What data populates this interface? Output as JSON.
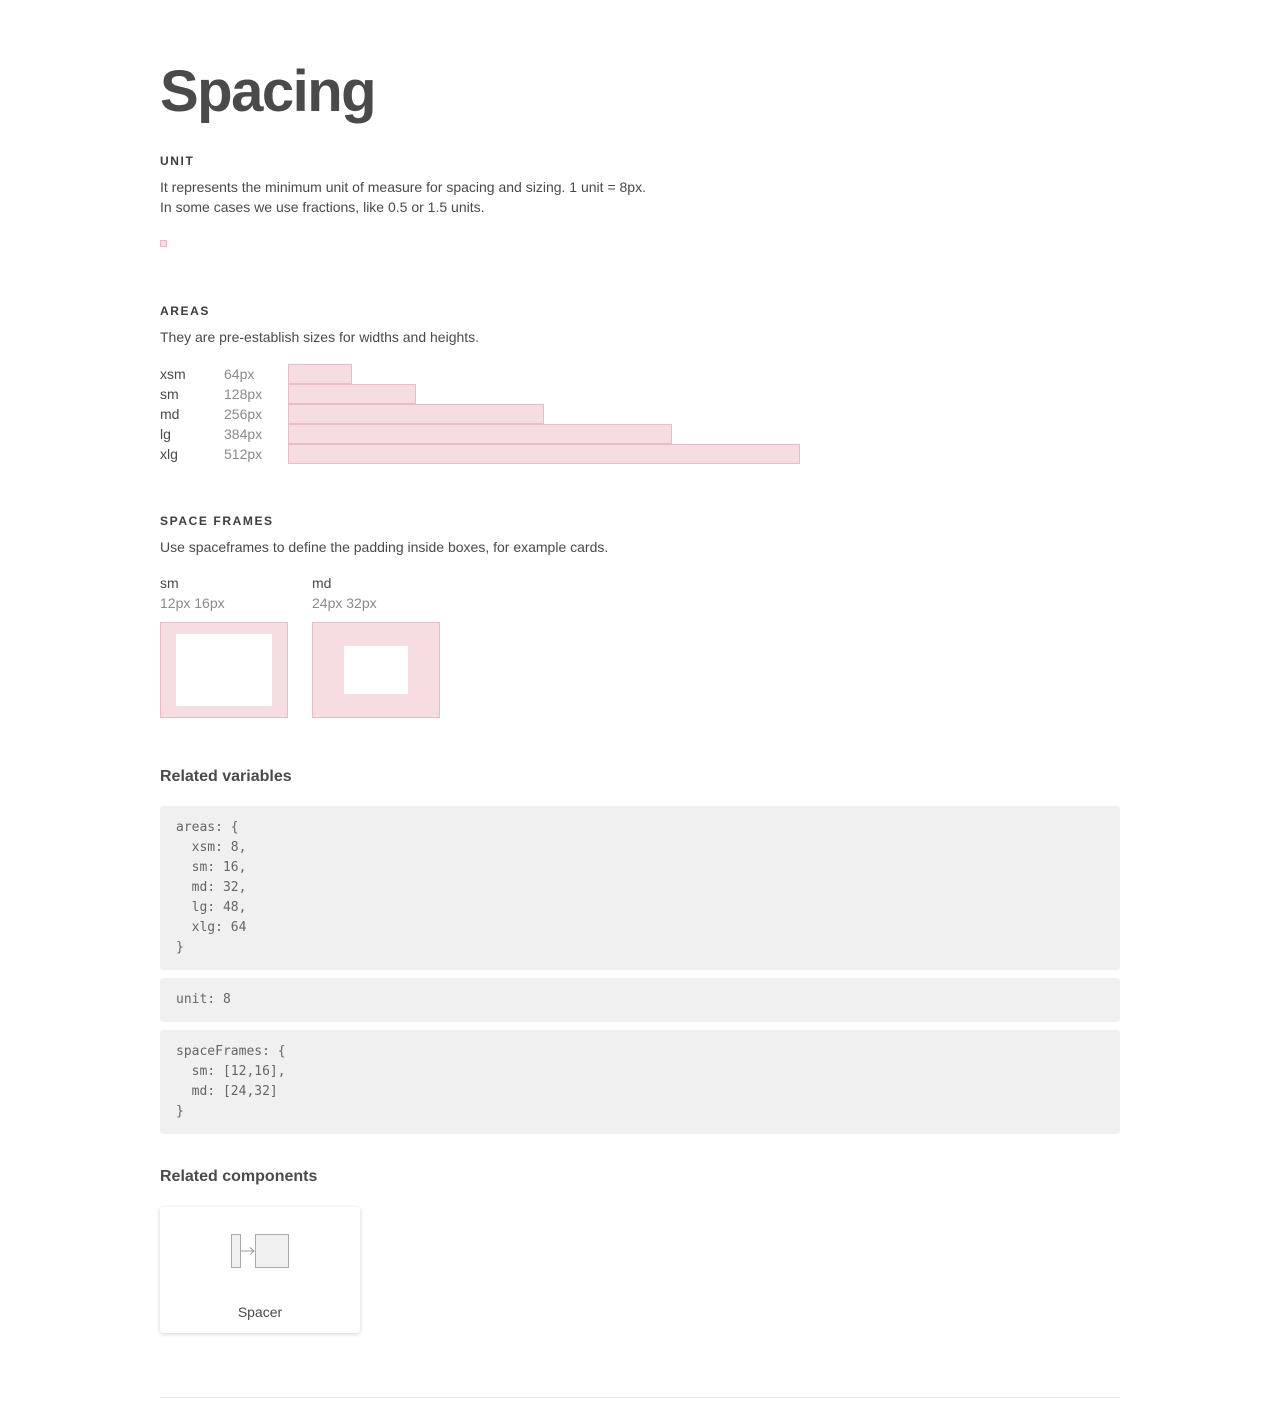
{
  "page": {
    "title": "Spacing"
  },
  "unit": {
    "label": "UNIT",
    "line1": "It represents the minimum unit of measure for spacing and sizing. 1 unit = 8px.",
    "line2": "In some cases we use fractions, like 0.5 or 1.5 units."
  },
  "areas": {
    "label": "AREAS",
    "description": "They are pre-establish sizes for widths and heights.",
    "rows": [
      {
        "name": "xsm",
        "size": "64px"
      },
      {
        "name": "sm",
        "size": "128px"
      },
      {
        "name": "md",
        "size": "256px"
      },
      {
        "name": "lg",
        "size": "384px"
      },
      {
        "name": "xlg",
        "size": "512px"
      }
    ]
  },
  "space_frames": {
    "label": "SPACE FRAMES",
    "description": "Use spaceframes to define the padding inside boxes, for example cards.",
    "frames": [
      {
        "name": "sm",
        "value": "12px 16px"
      },
      {
        "name": "md",
        "value": "24px 32px"
      }
    ]
  },
  "related_variables": {
    "heading": "Related variables",
    "blocks": [
      "areas: {\n  xsm: 8,\n  sm: 16,\n  md: 32,\n  lg: 48,\n  xlg: 64\n}",
      "unit: 8",
      "spaceFrames: {\n  sm: [12,16],\n  md: [24,32]\n}"
    ]
  },
  "related_components": {
    "heading": "Related components",
    "items": [
      {
        "label": "Spacer",
        "icon": "spacer-icon"
      }
    ]
  },
  "colors": {
    "swatch_fill": "#f5dde2",
    "swatch_border": "#ebbcc6",
    "code_bg": "#f0f0f0",
    "text": "#4a4a4a",
    "muted": "#8a8a8a"
  }
}
